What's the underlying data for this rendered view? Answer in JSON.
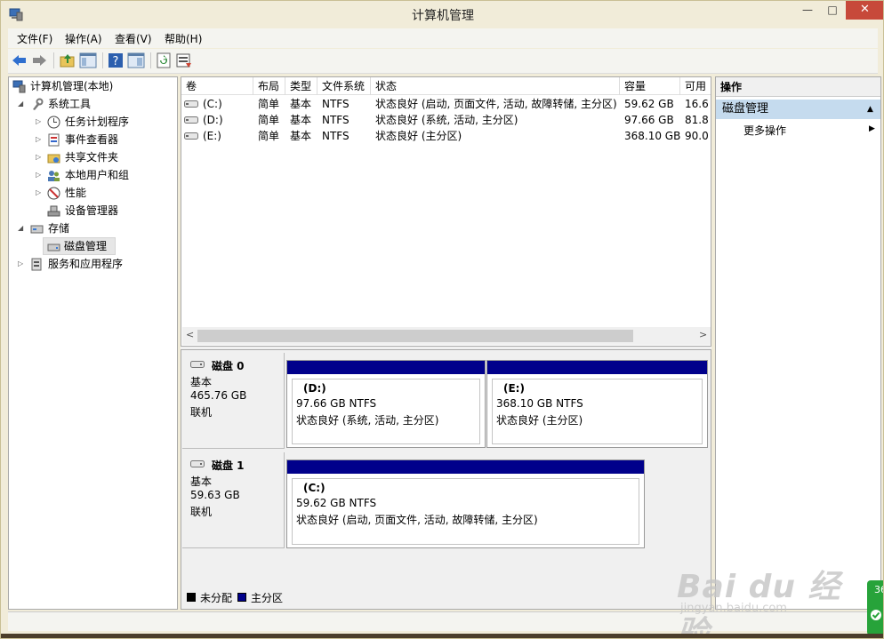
{
  "window": {
    "title": "计算机管理",
    "min_glyph": "—",
    "max_glyph": "□",
    "close_glyph": "✕"
  },
  "menubar": {
    "items": [
      "文件(F)",
      "操作(A)",
      "查看(V)",
      "帮助(H)"
    ]
  },
  "toolbar": {
    "icons": [
      "back-arrow-icon",
      "forward-arrow-icon",
      "up-folder-icon",
      "console-tree-icon",
      "help-icon",
      "properties-icon",
      "refresh-icon",
      "export-icon"
    ]
  },
  "tree": {
    "root": "计算机管理(本地)",
    "system_tools": "系统工具",
    "task_scheduler": "任务计划程序",
    "event_viewer": "事件查看器",
    "shared_folders": "共享文件夹",
    "local_users": "本地用户和组",
    "performance": "性能",
    "device_manager": "设备管理器",
    "storage": "存储",
    "disk_management": "磁盘管理",
    "services_apps": "服务和应用程序"
  },
  "volume_table": {
    "headers": [
      "卷",
      "布局",
      "类型",
      "文件系统",
      "状态",
      "容量",
      "可用"
    ],
    "rows": [
      [
        "(C:)",
        "简单",
        "基本",
        "NTFS",
        "状态良好 (启动, 页面文件, 活动, 故障转储, 主分区)",
        "59.62 GB",
        "16.6"
      ],
      [
        "(D:)",
        "简单",
        "基本",
        "NTFS",
        "状态良好 (系统, 活动, 主分区)",
        "97.66 GB",
        "81.8"
      ],
      [
        "(E:)",
        "简单",
        "基本",
        "NTFS",
        "状态良好 (主分区)",
        "368.10 GB",
        "90.0"
      ]
    ],
    "scroll_left": "<",
    "scroll_right": ">"
  },
  "disks": [
    {
      "name": "磁盘 0",
      "type": "基本",
      "size": "465.76 GB",
      "status": "联机",
      "partitions": [
        {
          "label": "(D:)",
          "size": "97.66 GB NTFS",
          "status": "状态良好 (系统, 活动, 主分区)"
        },
        {
          "label": "(E:)",
          "size": "368.10 GB NTFS",
          "status": "状态良好 (主分区)"
        }
      ]
    },
    {
      "name": "磁盘 1",
      "type": "基本",
      "size": "59.63 GB",
      "status": "联机",
      "partitions": [
        {
          "label": "(C:)",
          "size": "59.62 GB NTFS",
          "status": "状态良好 (启动, 页面文件, 活动, 故障转储, 主分区)"
        }
      ]
    }
  ],
  "legend": {
    "unallocated": "未分配",
    "primary": "主分区",
    "unallocated_color": "#000000",
    "primary_color": "#00008b"
  },
  "actions": {
    "header": "操作",
    "section": "磁盘管理",
    "more": "更多操作",
    "collapse_glyph": "▲",
    "more_glyph": "▶"
  },
  "watermark": {
    "logo": "Bai du 经验",
    "url": "jingyan.baidu.com"
  },
  "badge": {
    "text": "36"
  },
  "colors": {
    "selection_bar": "#c5dbee",
    "partition_bar": "#00008b",
    "close_button": "#c7493a"
  }
}
